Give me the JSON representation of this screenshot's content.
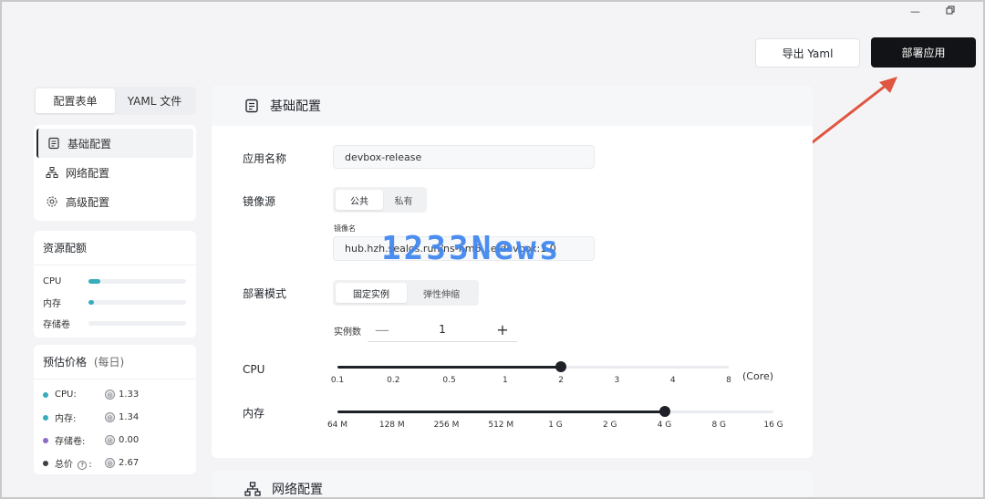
{
  "window": {
    "minimize_icon": "minimize-icon",
    "restore_icon": "restore-icon"
  },
  "header": {
    "export_label": "导出 Yaml",
    "deploy_label": "部署应用"
  },
  "view_tabs": [
    {
      "label": "配置表单",
      "active": true
    },
    {
      "label": "YAML 文件",
      "active": false
    }
  ],
  "nav": {
    "items": [
      {
        "label": "基础配置",
        "icon": "document-icon",
        "active": true
      },
      {
        "label": "网络配置",
        "icon": "network-icon",
        "active": false
      },
      {
        "label": "高级配置",
        "icon": "gear-icon",
        "active": false
      }
    ]
  },
  "resources": {
    "title": "资源配额",
    "items": [
      {
        "label": "CPU",
        "fill": 0.12
      },
      {
        "label": "内存",
        "fill": 0.06
      },
      {
        "label": "存储卷",
        "fill": 0
      }
    ]
  },
  "price": {
    "title": "预估价格",
    "period": "(每日)",
    "items": [
      {
        "label": "CPU:",
        "value": "1.33",
        "color": "#36adbd"
      },
      {
        "label": "内存:",
        "value": "1.34",
        "color": "#36adbd"
      },
      {
        "label": "存储卷:",
        "value": "0.00",
        "color": "#8b6cc7"
      },
      {
        "label": "总价",
        "value": "2.67",
        "color": "#3c3f46",
        "has_help": true
      }
    ]
  },
  "basic": {
    "title": "基础配置",
    "app_name_label": "应用名称",
    "app_name_value": "devbox-release",
    "image_source_label": "镜像源",
    "image_source_options": [
      {
        "label": "公共",
        "active": true
      },
      {
        "label": "私有",
        "active": false
      }
    ],
    "image_name_label": "镜像名",
    "image_name_value": "hub.hzh.sealos.run/ns-hm6...e/devbox:1.0",
    "deploy_mode_label": "部署模式",
    "deploy_mode_options": [
      {
        "label": "固定实例",
        "active": true
      },
      {
        "label": "弹性伸缩",
        "active": false
      }
    ],
    "instances_label": "实例数",
    "instances_value": "1",
    "minus": "—",
    "plus": "+",
    "cpu_label": "CPU",
    "cpu_ticks": [
      "0.1",
      "0.2",
      "0.5",
      "1",
      "2",
      "3",
      "4",
      "8"
    ],
    "cpu_selected_index": 4,
    "cpu_unit": "(Core)",
    "memory_label": "内存",
    "memory_ticks": [
      "64 M",
      "128 M",
      "256 M",
      "512 M",
      "1 G",
      "2 G",
      "4 G",
      "8 G",
      "16 G"
    ],
    "memory_selected_index": 6
  },
  "network": {
    "title": "网络配置"
  },
  "watermark": "1233News"
}
